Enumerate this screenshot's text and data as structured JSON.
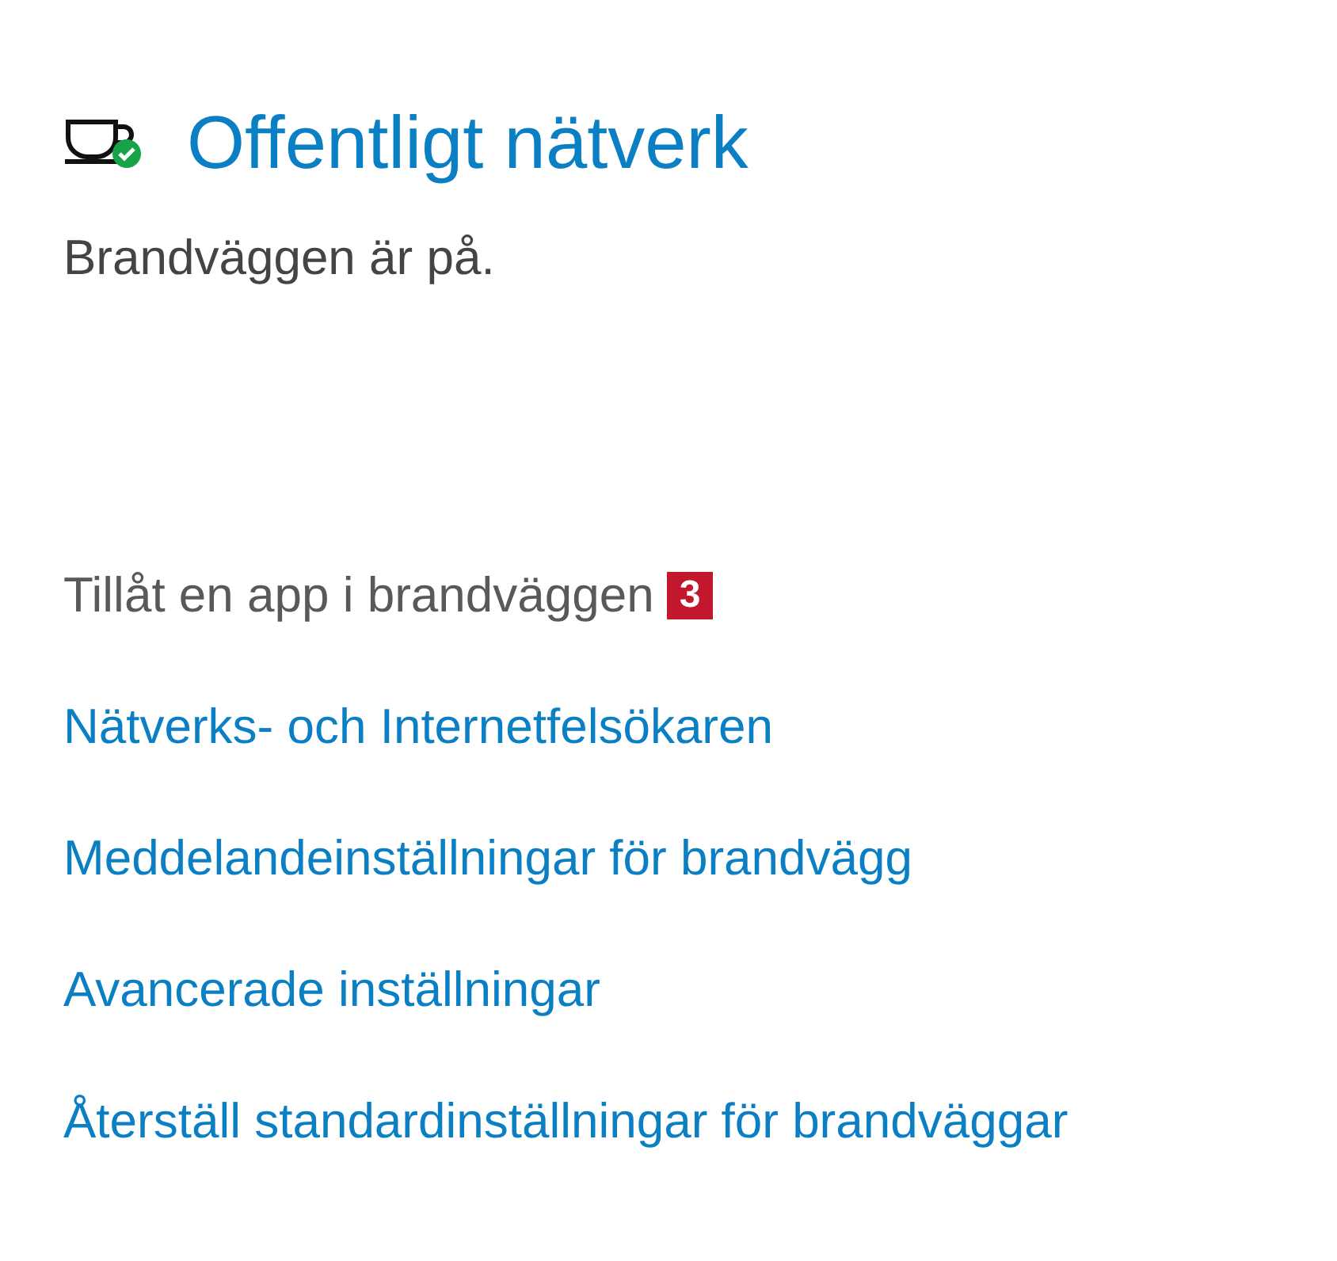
{
  "network": {
    "title": "Offentligt nätverk",
    "status": "Brandväggen är på.",
    "protected": true
  },
  "links": [
    {
      "label": "Tillåt en app i brandväggen",
      "disabled": true,
      "badge": "3"
    },
    {
      "label": "Nätverks- och Internetfelsökaren",
      "disabled": false
    },
    {
      "label": "Meddelandeinställningar för brandvägg",
      "disabled": false
    },
    {
      "label": "Avancerade inställningar",
      "disabled": false
    },
    {
      "label": "Återställ standardinställningar för brandväggar",
      "disabled": false
    }
  ]
}
